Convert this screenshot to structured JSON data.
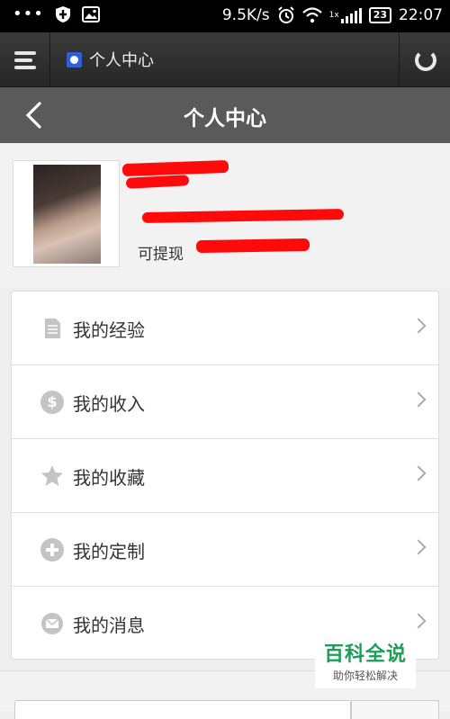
{
  "status_bar": {
    "dots": "•••",
    "net_speed": "9.5K/s",
    "net_type": "1x",
    "battery": "23",
    "time": "22:07"
  },
  "browser": {
    "tab_title": "个人中心"
  },
  "page": {
    "title": "个人中心"
  },
  "profile": {
    "withdraw_label": "可提现"
  },
  "menu": {
    "items": [
      {
        "label": "我的经验",
        "icon": "document-icon"
      },
      {
        "label": "我的收入",
        "icon": "dollar-icon"
      },
      {
        "label": "我的收藏",
        "icon": "star-icon"
      },
      {
        "label": "我的定制",
        "icon": "plus-circle-icon"
      },
      {
        "label": "我的消息",
        "icon": "envelope-icon"
      }
    ]
  },
  "watermark": {
    "main": "百科全说",
    "sub": "助你轻松解决"
  },
  "colors": {
    "header_bg": "#5a5a5a",
    "toolbar_bg": "#2e2e2e",
    "redaction": "#ff0a0a",
    "watermark_green": "#1aa055",
    "icon_gray": "#c4c4c4"
  }
}
